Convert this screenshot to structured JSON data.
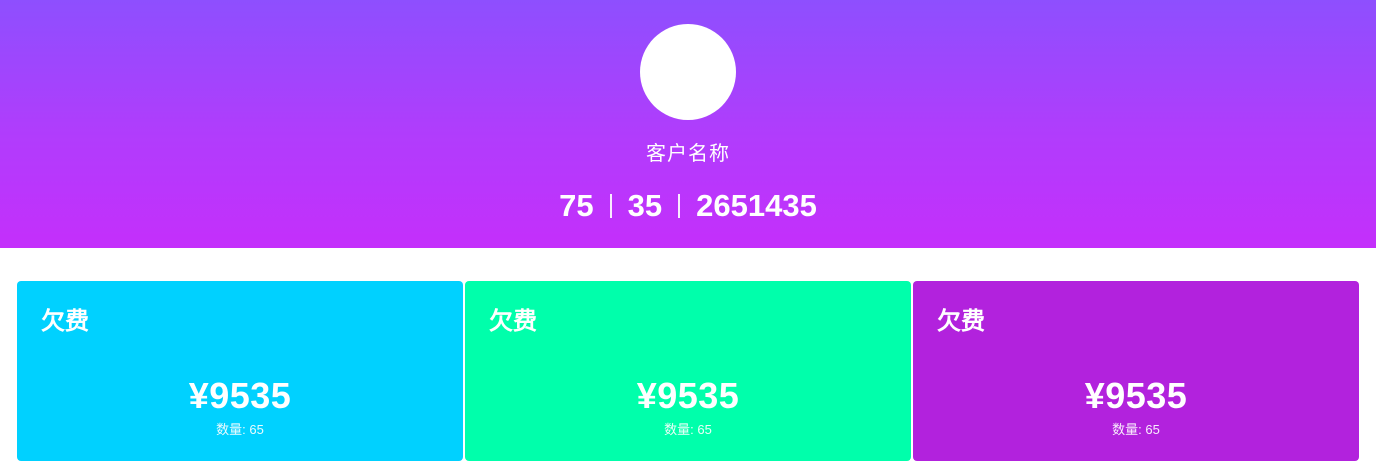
{
  "header": {
    "customer_name": "客户名称",
    "stats": [
      "75",
      "35",
      "2651435"
    ]
  },
  "cards": [
    {
      "title": "欠费",
      "amount": "¥9535",
      "count_label": "数量: ",
      "count": "65",
      "color": "#00d1ff"
    },
    {
      "title": "欠费",
      "amount": "¥9535",
      "count_label": "数量: ",
      "count": "65",
      "color": "#00ffab"
    },
    {
      "title": "欠费",
      "amount": "¥9535",
      "count_label": "数量: ",
      "count": "65",
      "color": "#b222dd"
    }
  ],
  "colors": {
    "header_gradient_top": "#8e4ffe",
    "header_gradient_bottom": "#c42ffb"
  }
}
